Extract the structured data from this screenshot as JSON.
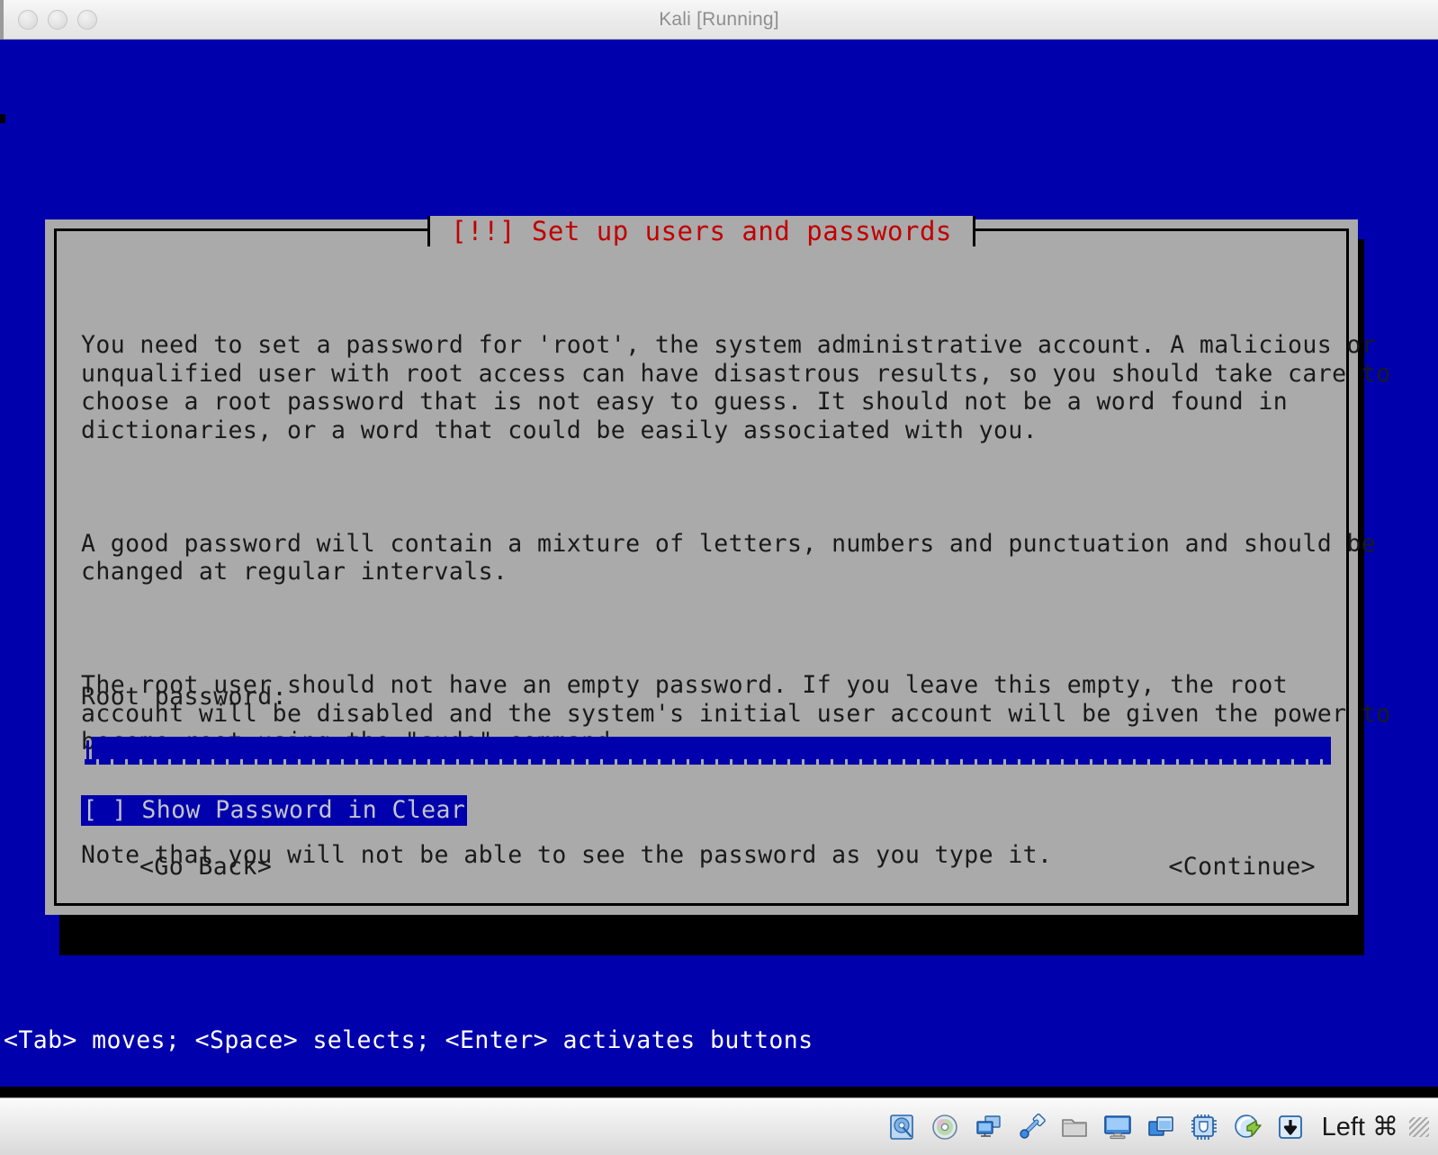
{
  "window": {
    "title": "Kali [Running]",
    "traffic_lights": [
      "close",
      "minimize",
      "zoom"
    ]
  },
  "colors": {
    "console_blue": "#0000ad",
    "dialog_gray": "#aaaaaa",
    "title_red": "#c00000",
    "text_black": "#1a1a1a",
    "highlight_text": "#c4c4cf"
  },
  "dialog": {
    "title": "[!!] Set up users and passwords",
    "paragraphs": [
      "You need to set a password for 'root', the system administrative account. A malicious or\nunqualified user with root access can have disastrous results, so you should take care to\nchoose a root password that is not easy to guess. It should not be a word found in\ndictionaries, or a word that could be easily associated with you.",
      "A good password will contain a mixture of letters, numbers and punctuation and should be\nchanged at regular intervals.",
      "The root user should not have an empty password. If you leave this empty, the root\naccount will be disabled and the system's initial user account will be given the power to\nbecome root using the \"sudo\" command.",
      "Note that you will not be able to see the password as you type it."
    ],
    "field_label": "Root password:",
    "password_value": "",
    "checkbox": {
      "label": "[ ] Show Password in Clear",
      "checked": false,
      "focused": true
    },
    "buttons": {
      "go_back": "<Go Back>",
      "continue": "<Continue>"
    }
  },
  "console": {
    "status_line": "<Tab> moves; <Space> selects; <Enter> activates buttons"
  },
  "vbox_statusbar": {
    "icons": [
      "hard-disk-icon",
      "optical-disk-icon",
      "network-icon",
      "usb-icon",
      "shared-folder-icon",
      "display-icon",
      "seamless-window-icon",
      "cpu-virtualization-icon",
      "mouse-integration-icon",
      "host-key-capture-icon"
    ],
    "host_key": "Left ⌘"
  }
}
